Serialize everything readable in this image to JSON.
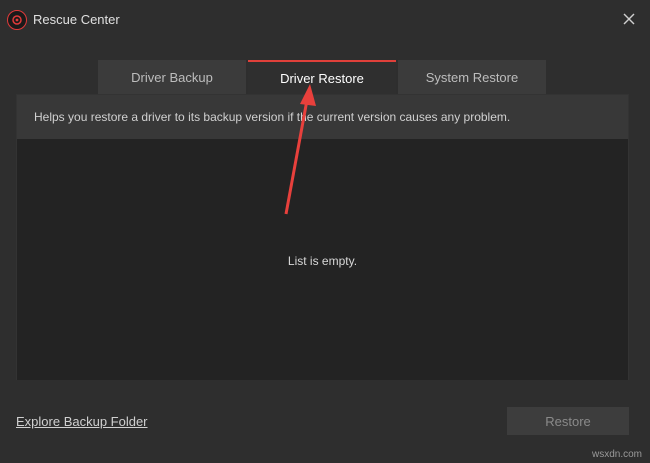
{
  "window": {
    "title": "Rescue Center",
    "close_icon": "close-icon",
    "logo_icon": "app-logo-icon"
  },
  "tabs": [
    {
      "label": "Driver Backup",
      "active": false
    },
    {
      "label": "Driver Restore",
      "active": true
    },
    {
      "label": "System Restore",
      "active": false
    }
  ],
  "panel": {
    "info_text": "Helps you restore a driver to its backup version if the current version causes any problem.",
    "empty_text": "List is empty."
  },
  "footer": {
    "explore_link": "Explore Backup Folder",
    "restore_button": "Restore"
  },
  "annotation": {
    "arrow_color": "#e8403c"
  },
  "colors": {
    "accent": "#e0403a",
    "background": "#2e2e2e"
  },
  "watermark": "wsxdn.com"
}
